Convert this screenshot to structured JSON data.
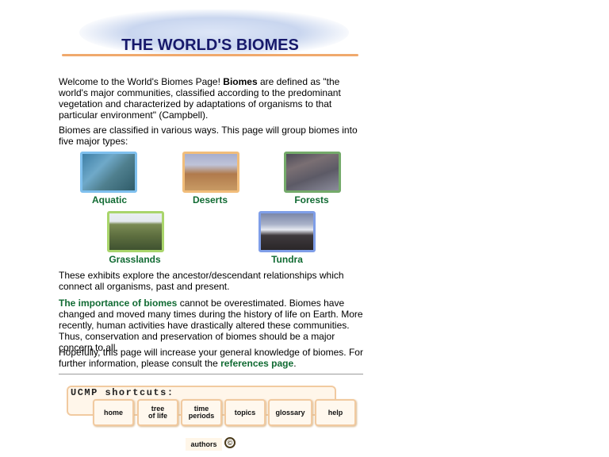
{
  "header": {
    "title": "THE WORLD'S BIOMES"
  },
  "intro": {
    "p1_lead": "Welcome to the World's Biomes Page! ",
    "p1_bold": "Biomes",
    "p1_rest": " are defined as \"the world's major communities, classified according to the predominant vegetation and characterized by adaptations of organisms to that particular environment\" (Campbell).",
    "p2": "Biomes are classified in various ways. This page will group biomes into five major types:"
  },
  "biomes": [
    {
      "label": "Aquatic",
      "border": "#7fc0ee"
    },
    {
      "label": "Deserts",
      "border": "#f1bd7a"
    },
    {
      "label": "Forests",
      "border": "#74aa6a"
    },
    {
      "label": "Grasslands",
      "border": "#a9d56b"
    },
    {
      "label": "Tundra",
      "border": "#7f9ee8"
    }
  ],
  "exhibits": "These exhibits explore the ancestor/descendant relationships which connect all organisms, past and present.",
  "importance": {
    "link": "The importance of biomes",
    "rest": " cannot be overestimated. Biomes have changed and moved many times during the history of life on Earth. More recently, human activities have drastically altered these communities. Thus, conservation and preservation of biomes should be a major concern to all."
  },
  "closing": {
    "lead": "Hopefully, this page will increase your general knowledge of biomes. For further information, please consult the ",
    "link": "references page",
    "tail": "."
  },
  "shortcuts": {
    "title": "UCMP shortcuts:",
    "home": "home",
    "tree_line1": "tree",
    "tree_line2": "of life",
    "time_line1": "time",
    "time_line2": "periods",
    "topics": "topics",
    "glossary": "glossary",
    "help": "help"
  },
  "footer": {
    "authors": "authors",
    "copyright": "©"
  },
  "colors": {
    "title": "#17196b",
    "link_green": "#116b33",
    "rule_orange": "#f0a96d"
  }
}
